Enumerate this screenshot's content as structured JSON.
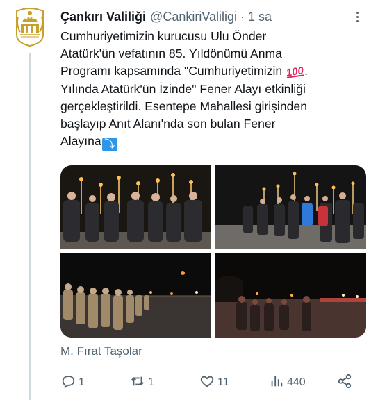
{
  "tweet": {
    "author_name": "Çankırı Valiliği",
    "author_handle": "@CankiriValiligi",
    "separator": "·",
    "time": "1 sa",
    "text_lines": [
      "Cumhuriyetimizin kurucusu Ulu Önder",
      "Atatürk'ün vefatının 85. Yıldönümü Anma",
      "Programı kapsamında \"Cumhuriyetimizin",
      "Yılında Atatürk'ün İzinde\" Fener Alayı etkinliği",
      "gerçekleştirildi. Esentepe Mahallesi girişinden",
      "başlayıp Anıt Alanı'nda son bulan Fener",
      "Alayına"
    ],
    "hundred_emoji": "100",
    "arrow_emoji": "⤵",
    "photo_credit": "M. Fırat Taşolar",
    "avatar_caption": "ÇANKIRI VALİLİĞİ"
  },
  "actions": {
    "reply_count": "1",
    "retweet_count": "1",
    "like_count": "11",
    "view_count": "440"
  },
  "icons": {
    "reply": "reply-icon",
    "retweet": "retweet-icon",
    "like": "heart-icon",
    "views": "views-icon",
    "share": "share-icon",
    "more": "more-icon"
  },
  "colors": {
    "brand_gold": "#c8a02e",
    "text_secondary": "#536471",
    "thread_line": "#cfd9de"
  }
}
